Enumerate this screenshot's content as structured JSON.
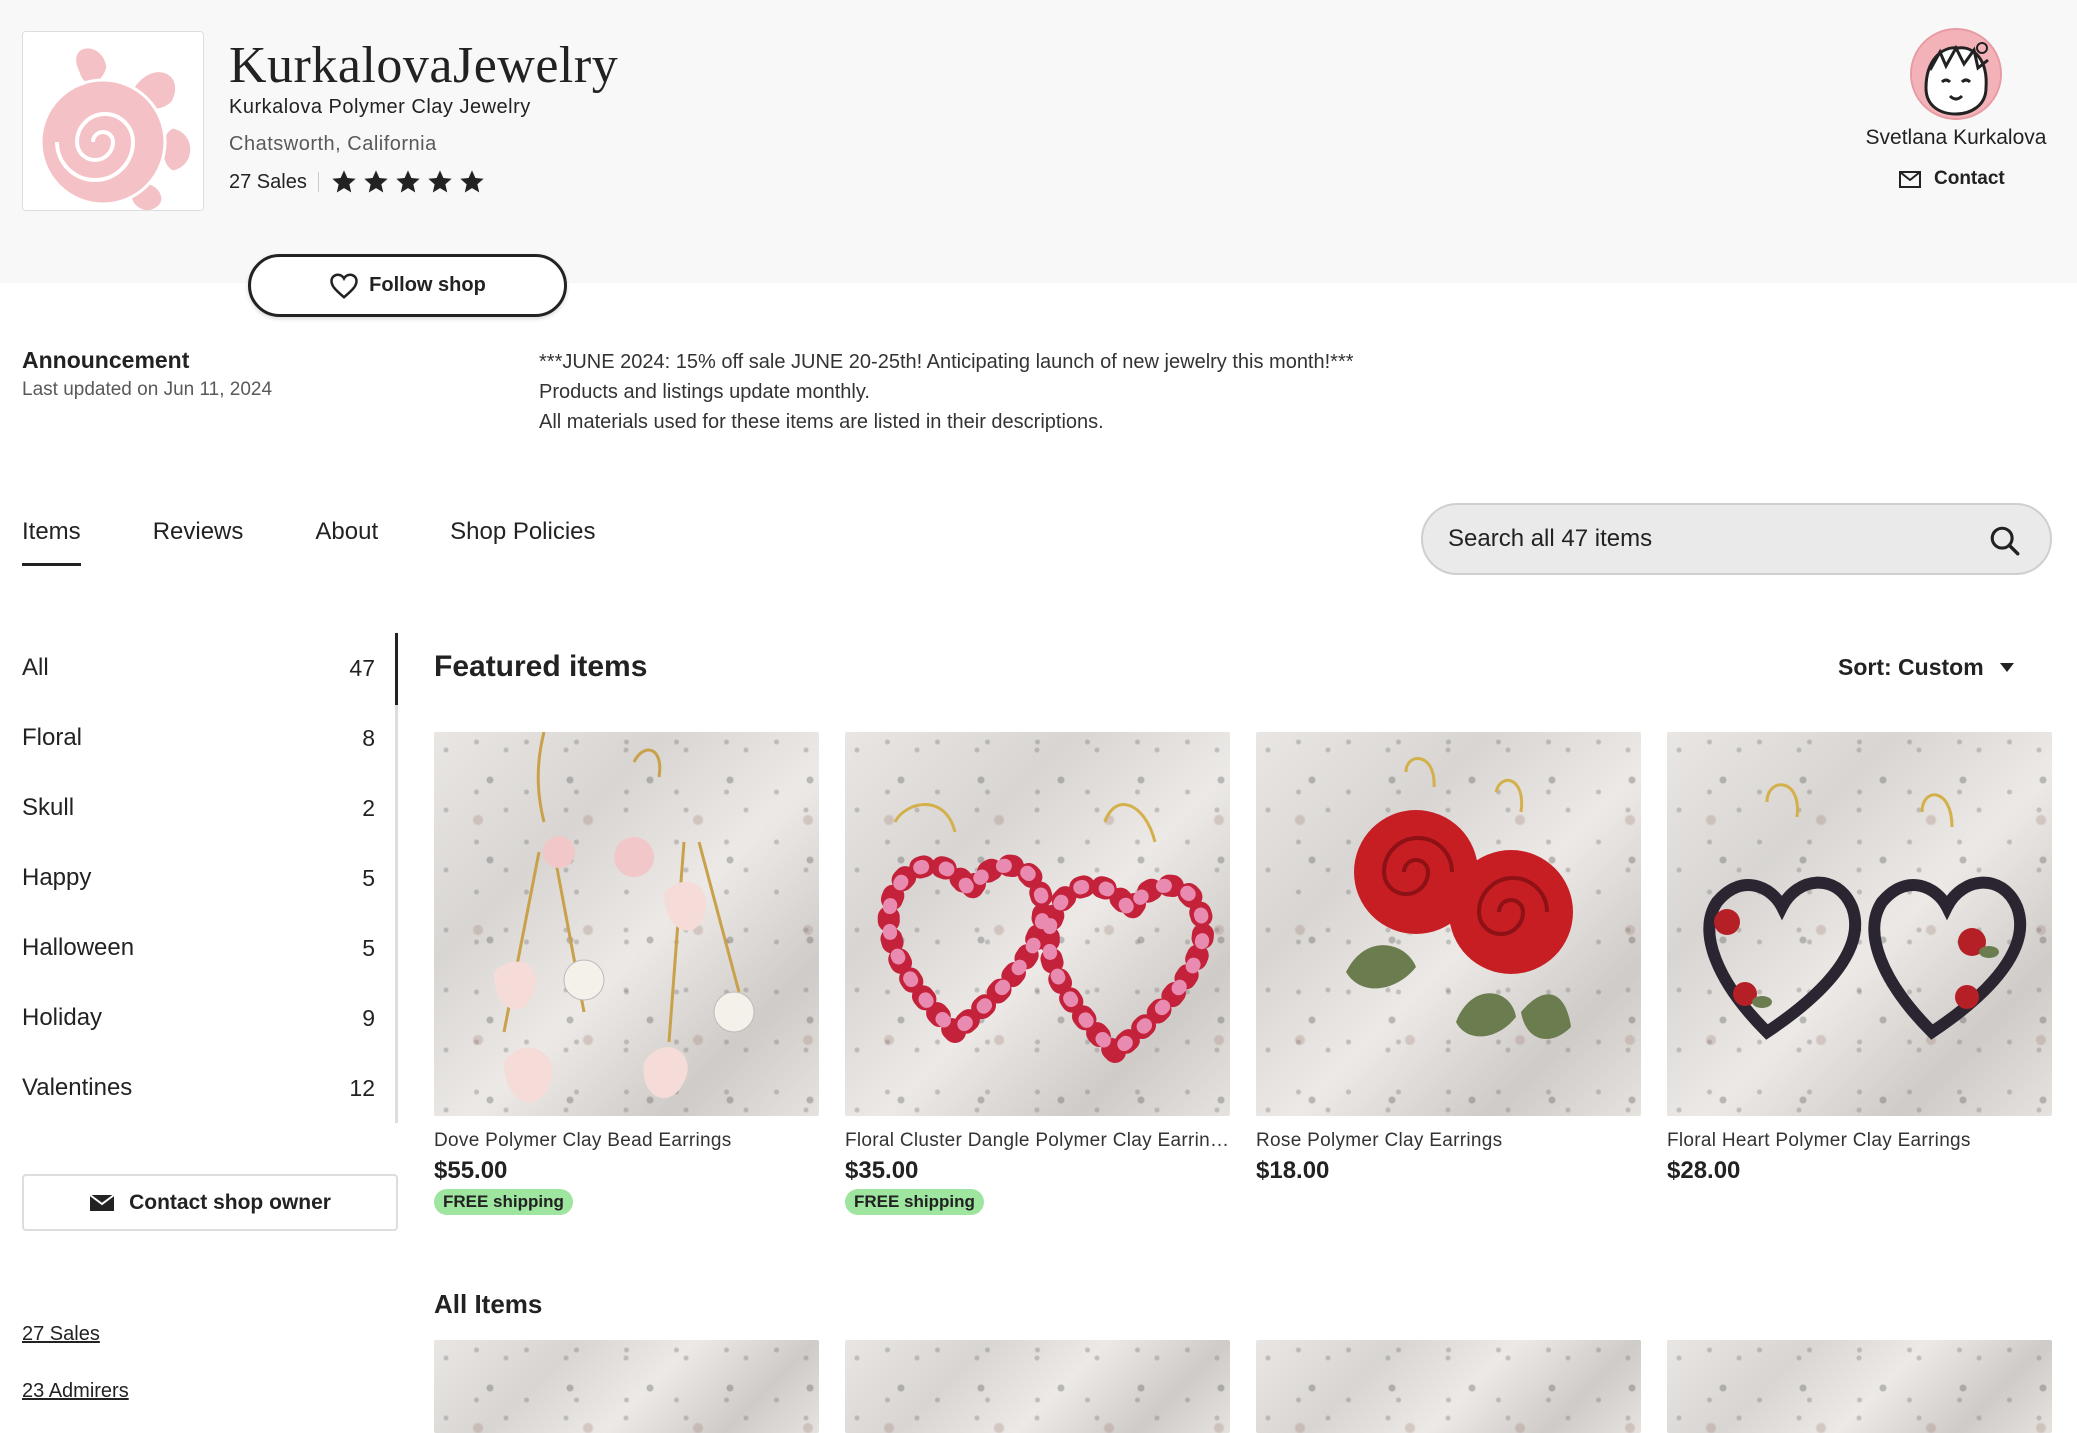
{
  "shop": {
    "name": "KurkalovaJewelry",
    "tagline": "Kurkalova Polymer Clay Jewelry",
    "location": "Chatsworth, California",
    "sales": "27 Sales",
    "rating_stars": 5,
    "follow_label": "Follow shop"
  },
  "owner": {
    "name": "Svetlana Kurkalova",
    "contact_label": "Contact"
  },
  "announcement": {
    "title": "Announcement",
    "updated": "Last updated on Jun 11, 2024",
    "lines": [
      "***JUNE 2024: 15% off sale JUNE 20-25th! Anticipating launch of new jewelry this month!***",
      "Products and listings update monthly.",
      "All materials used for these items are listed in their descriptions."
    ]
  },
  "tabs": [
    {
      "label": "Items",
      "active": true
    },
    {
      "label": "Reviews",
      "active": false
    },
    {
      "label": "About",
      "active": false
    },
    {
      "label": "Shop Policies",
      "active": false
    }
  ],
  "search": {
    "placeholder": "Search all 47 items"
  },
  "sidebar": {
    "categories": [
      {
        "label": "All",
        "count": "47"
      },
      {
        "label": "Floral",
        "count": "8"
      },
      {
        "label": "Skull",
        "count": "2"
      },
      {
        "label": "Happy",
        "count": "5"
      },
      {
        "label": "Halloween",
        "count": "5"
      },
      {
        "label": "Holiday",
        "count": "9"
      },
      {
        "label": "Valentines",
        "count": "12"
      }
    ],
    "contact_owner_label": "Contact shop owner",
    "sales_link": "27 Sales",
    "admirers_link": "23 Admirers"
  },
  "featured": {
    "title": "Featured items",
    "sort_label": "Sort: Custom",
    "items": [
      {
        "title": "Dove Polymer Clay Bead Earrings",
        "price": "$55.00",
        "shipping": "FREE shipping"
      },
      {
        "title": "Floral Cluster Dangle Polymer Clay Earrings",
        "price": "$35.00",
        "shipping": "FREE shipping"
      },
      {
        "title": "Rose Polymer Clay Earrings",
        "price": "$18.00",
        "shipping": ""
      },
      {
        "title": "Floral Heart Polymer Clay Earrings",
        "price": "$28.00",
        "shipping": ""
      }
    ]
  },
  "all_items": {
    "title": "All Items"
  },
  "colors": {
    "accent": "#222222",
    "free_shipping_bg": "#9ee59f",
    "header_bg": "#f8f8f8",
    "logo_pink": "#f4c2c6"
  }
}
